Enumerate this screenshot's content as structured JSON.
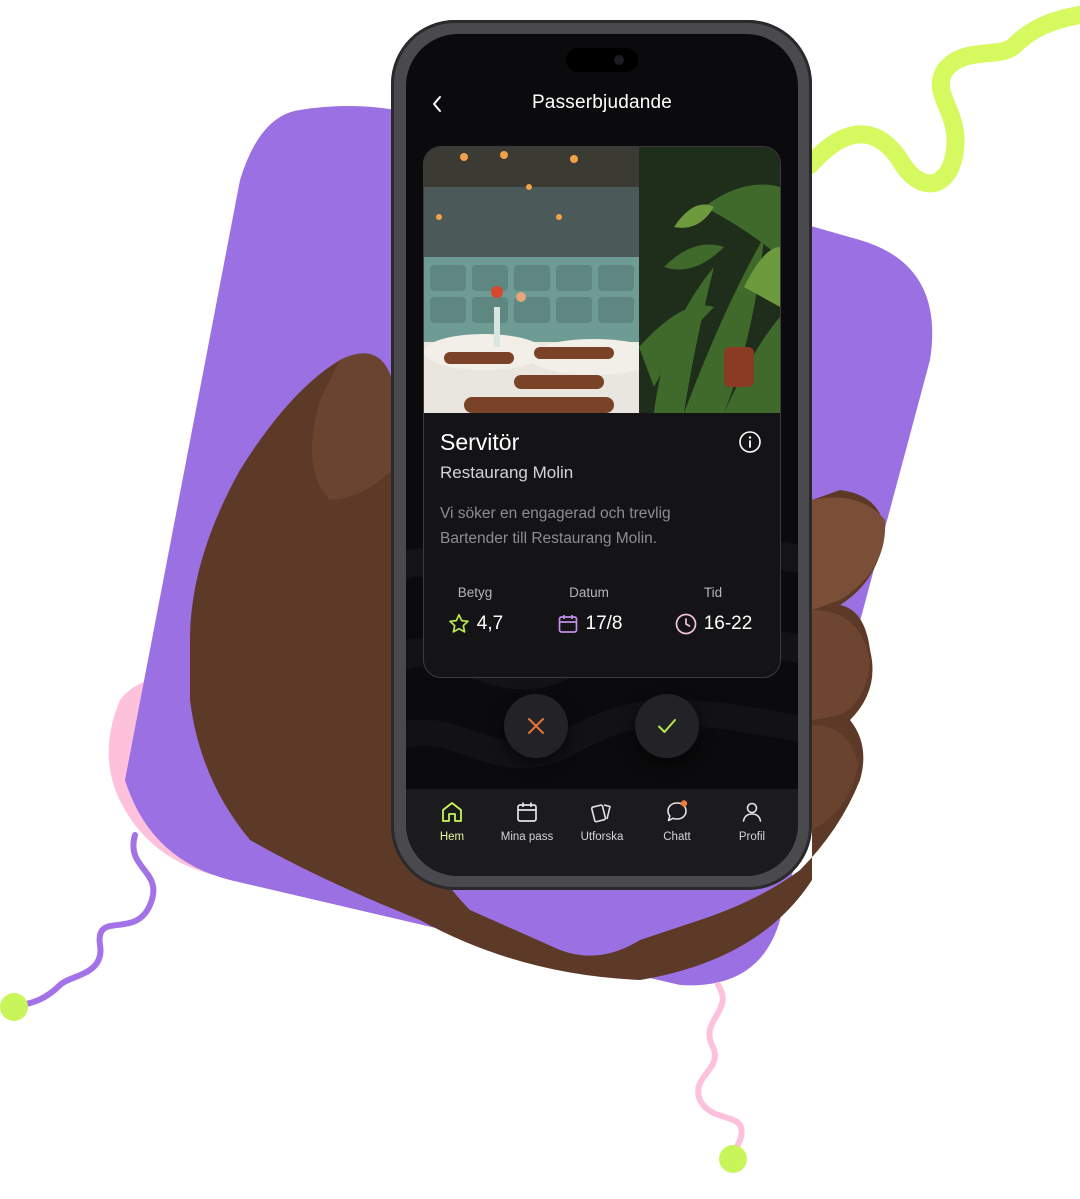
{
  "header": {
    "title": "Passerbjudande"
  },
  "job": {
    "title": "Servitör",
    "company": "Restaurang Molin",
    "description": "Vi söker en engagerad och trevlig Bartender till Restaurang Molin."
  },
  "stats": {
    "rating": {
      "label": "Betyg",
      "value": "4,7"
    },
    "date": {
      "label": "Datum",
      "value": "17/8"
    },
    "time": {
      "label": "Tid",
      "value": "16-22"
    }
  },
  "actions": {
    "decline_icon": "close-icon",
    "accept_icon": "check-icon"
  },
  "tabs": [
    {
      "label": "Hem",
      "icon": "home-icon"
    },
    {
      "label": "Mina pass",
      "icon": "calendar-icon"
    },
    {
      "label": "Utforska",
      "icon": "cards-icon"
    },
    {
      "label": "Chatt",
      "icon": "chat-icon"
    },
    {
      "label": "Profil",
      "icon": "profile-icon"
    }
  ],
  "colors": {
    "purple": "#9b70e3",
    "lime": "#c8f55a",
    "pink": "#fdc1dc",
    "accent_star": "#b9e84e",
    "accent_calendar": "#c08fe8",
    "accent_clock": "#f5c3d9",
    "decline": "#e8743a",
    "accept": "#b9e84e"
  }
}
